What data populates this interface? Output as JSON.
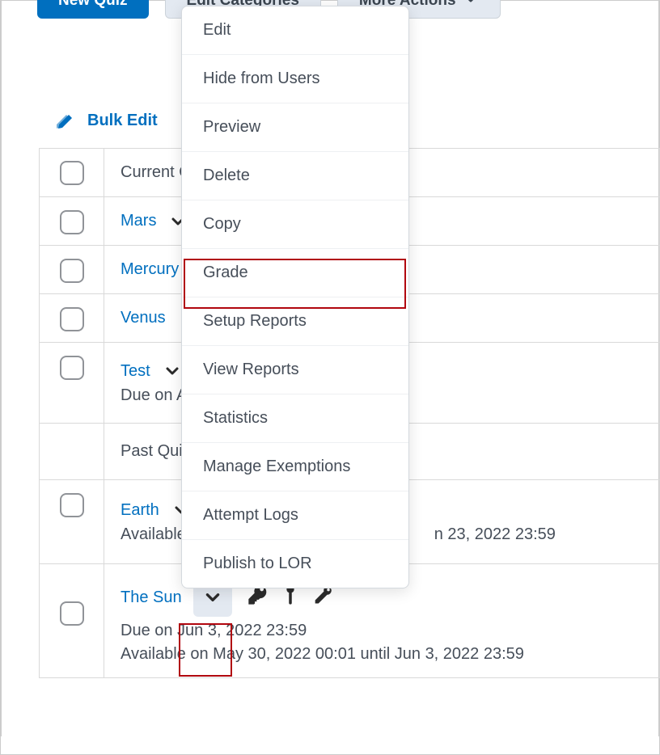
{
  "toolbar": {
    "new_quiz": "New Quiz",
    "edit_categories": "Edit Categories",
    "more_actions": "More Actions"
  },
  "bulk_edit_label": "Bulk Edit",
  "categories": {
    "current": "Current Q",
    "past": "Past Quiz"
  },
  "quizzes": {
    "mars": {
      "name": "Mars"
    },
    "mercury": {
      "name": "Mercury"
    },
    "venus": {
      "name": "Venus"
    },
    "test": {
      "name": "Test",
      "due": "Due on A"
    },
    "earth": {
      "name": "Earth",
      "avail": "Available on",
      "avail_tail": "n 23, 2022 23:59"
    },
    "sun": {
      "name": "The Sun",
      "due": "Due on Jun 3, 2022 23:59",
      "avail": "Available on May 30, 2022 00:01 until Jun 3, 2022 23:59"
    }
  },
  "menu": {
    "edit": "Edit",
    "hide": "Hide from Users",
    "preview": "Preview",
    "delete": "Delete",
    "copy": "Copy",
    "grade": "Grade",
    "setup_reports": "Setup Reports",
    "view_reports": "View Reports",
    "statistics": "Statistics",
    "manage_exemptions": "Manage Exemptions",
    "attempt_logs": "Attempt Logs",
    "publish_lor": "Publish to LOR"
  }
}
